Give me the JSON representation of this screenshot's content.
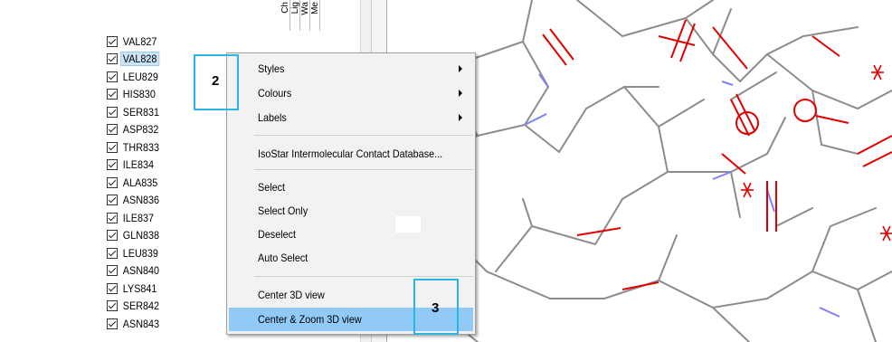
{
  "column_headers": [
    "Ch",
    "Lig",
    "Wa",
    "Me"
  ],
  "residues": [
    {
      "label": "VAL827",
      "checked": true,
      "selected": false
    },
    {
      "label": "VAL828",
      "checked": true,
      "selected": true
    },
    {
      "label": "LEU829",
      "checked": true,
      "selected": false
    },
    {
      "label": "HIS830",
      "checked": true,
      "selected": false
    },
    {
      "label": "SER831",
      "checked": true,
      "selected": false
    },
    {
      "label": "ASP832",
      "checked": true,
      "selected": false
    },
    {
      "label": "THR833",
      "checked": true,
      "selected": false
    },
    {
      "label": "ILE834",
      "checked": true,
      "selected": false
    },
    {
      "label": "ALA835",
      "checked": true,
      "selected": false
    },
    {
      "label": "ASN836",
      "checked": true,
      "selected": false
    },
    {
      "label": "ILE837",
      "checked": true,
      "selected": false
    },
    {
      "label": "GLN838",
      "checked": true,
      "selected": false
    },
    {
      "label": "LEU839",
      "checked": true,
      "selected": false
    },
    {
      "label": "ASN840",
      "checked": true,
      "selected": false
    },
    {
      "label": "LYS841",
      "checked": true,
      "selected": false
    },
    {
      "label": "SER842",
      "checked": true,
      "selected": false
    },
    {
      "label": "ASN843",
      "checked": true,
      "selected": false
    }
  ],
  "context_menu": {
    "items": [
      {
        "label": "Styles",
        "submenu": true
      },
      {
        "label": "Colours",
        "submenu": true
      },
      {
        "label": "Labels",
        "submenu": true
      },
      {
        "label": "IsoStar Intermolecular Contact Database...",
        "submenu": false
      },
      {
        "label": "Select",
        "submenu": false
      },
      {
        "label": "Select Only",
        "submenu": false
      },
      {
        "label": "Deselect",
        "submenu": false
      },
      {
        "label": "Auto Select",
        "submenu": false
      },
      {
        "label": "Center 3D view",
        "submenu": false
      },
      {
        "label": "Center & Zoom 3D view",
        "submenu": false,
        "highlighted": true
      }
    ]
  },
  "callouts": {
    "step2": "2",
    "step3": "3"
  },
  "colors": {
    "accent_callout": "#29b6e6",
    "menu_highlight": "#91c9f7",
    "bond_grey": "#8c8c8c",
    "bond_red": "#e00000",
    "bond_blue": "#8080ff"
  }
}
